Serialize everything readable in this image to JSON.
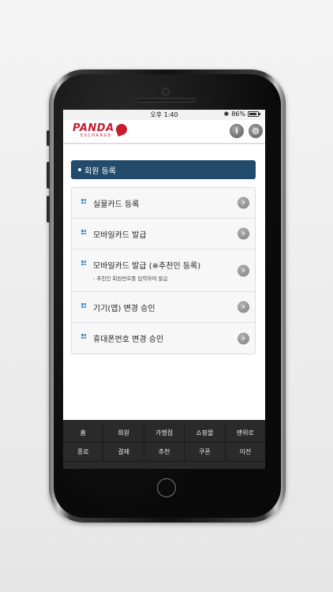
{
  "status": {
    "time": "오후 1:40",
    "battery": "86%",
    "battery_level": 0.86,
    "bluetooth_icon": "bluetooth-icon"
  },
  "header": {
    "logo_main": "PANDA",
    "logo_sub": "EXCHANGE",
    "info_icon": "info-icon",
    "settings_icon": "gear-icon"
  },
  "section": {
    "title": "회원 등록"
  },
  "menu": [
    {
      "label": "실물카드 등록",
      "sub": ""
    },
    {
      "label": "모바일카드 발급",
      "sub": ""
    },
    {
      "label": "모바일카드 발급 (※추천인 등록)",
      "sub": "- 추천인 회원번호를 입력하여 발급"
    },
    {
      "label": "기기(앱) 변경 승인",
      "sub": ""
    },
    {
      "label": "휴대폰번호 변경 승인",
      "sub": ""
    }
  ],
  "nav": {
    "row1": [
      "홈",
      "회원",
      "가맹점",
      "쇼핑몰",
      "맨위로"
    ],
    "row2": [
      "종료",
      "결제",
      "추천",
      "쿠폰",
      "이전"
    ]
  },
  "colors": {
    "brand": "#c51d2e",
    "section_bar": "#214a6b",
    "bullet": "#3d8fd1"
  }
}
